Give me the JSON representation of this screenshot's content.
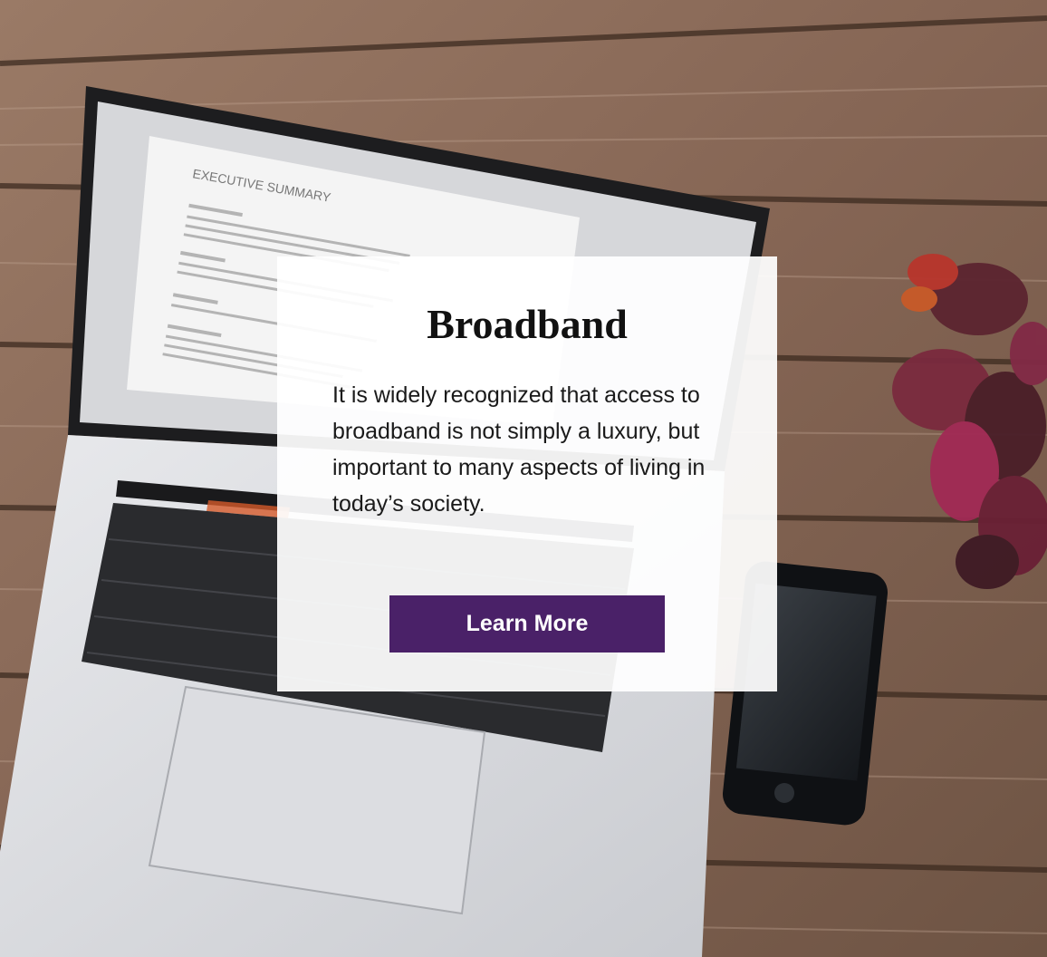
{
  "hero": {
    "title": "Broadband",
    "description": "It is widely recognized that access to broadband is not simply a luxury, but important to many aspects of living in today’s society.",
    "button_label": "Learn More"
  },
  "background": {
    "screen_heading": "EXECUTIVE SUMMARY"
  },
  "colors": {
    "button": "#4a2168",
    "card": "#ffffff",
    "wood": "#8a6a55"
  }
}
